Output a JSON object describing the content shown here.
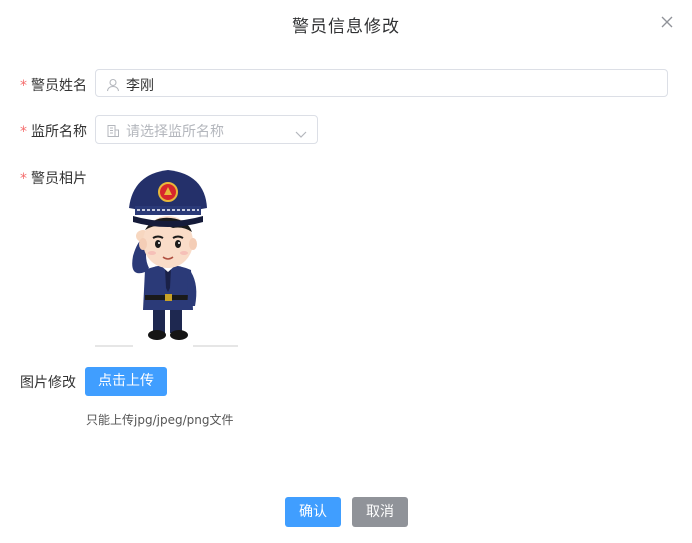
{
  "dialog": {
    "title": "警员信息修改"
  },
  "form": {
    "required_mark": "*",
    "name_label": "警员姓名",
    "name_value": "李刚",
    "prison_label": "监所名称",
    "prison_placeholder": "请选择监所名称",
    "photo_label": "警员相片",
    "photo_change_label": "图片修改",
    "upload_button": "点击上传",
    "upload_hint": "只能上传jpg/jpeg/png文件"
  },
  "footer": {
    "confirm": "确认",
    "cancel": "取消"
  },
  "colors": {
    "primary": "#409eff",
    "cancel_bg": "#909399",
    "required": "#f56c6c"
  }
}
